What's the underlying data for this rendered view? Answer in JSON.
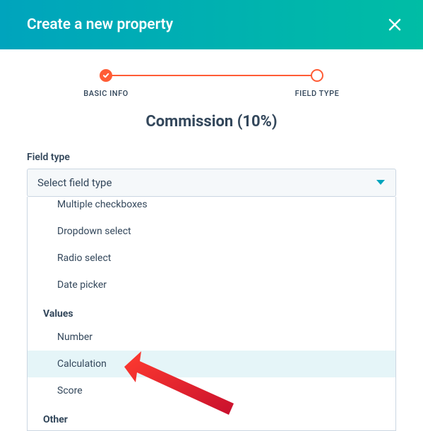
{
  "header": {
    "title": "Create a new property"
  },
  "stepper": {
    "step1": "BASIC INFO",
    "step2": "FIELD TYPE"
  },
  "property_name": "Commission (10%)",
  "field": {
    "label": "Field type",
    "placeholder": "Select field type"
  },
  "dropdown": {
    "items_top": [
      "Multiple checkboxes",
      "Dropdown select",
      "Radio select",
      "Date picker"
    ],
    "group_values": "Values",
    "values_items": {
      "number": "Number",
      "calculation": "Calculation",
      "score": "Score"
    },
    "group_other": "Other"
  }
}
